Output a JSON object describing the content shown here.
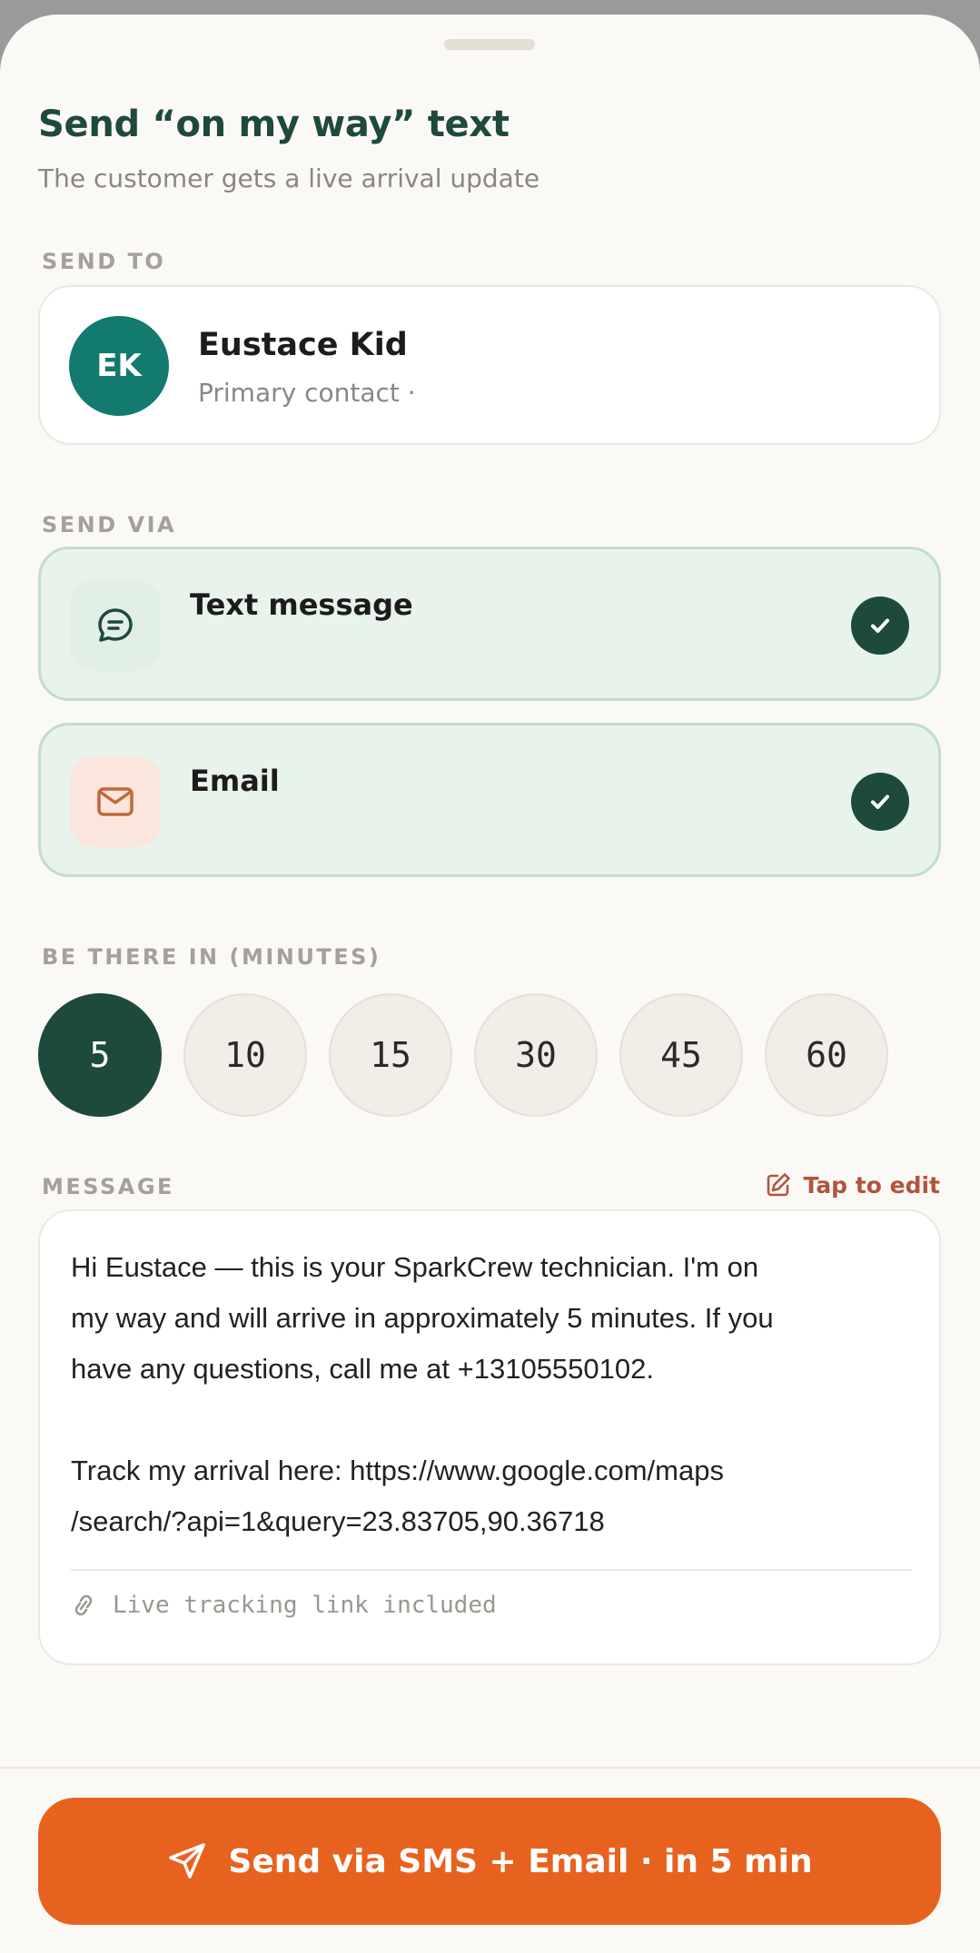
{
  "header": {
    "title": "Send “on my way” text",
    "subtitle": "The customer gets a live arrival update"
  },
  "send_to": {
    "label": "SEND TO",
    "initials": "EK",
    "name": "Eustace Kid",
    "subtitle": "Primary contact ·",
    "avatar_color": "#127a6e"
  },
  "send_via": {
    "label": "SEND VIA",
    "options": [
      {
        "label": "Text message",
        "icon": "chat-bubble-icon",
        "checked": true
      },
      {
        "label": "Email",
        "icon": "mail-icon",
        "checked": true
      }
    ]
  },
  "eta": {
    "label": "BE THERE IN (MINUTES)",
    "options": [
      "5",
      "10",
      "15",
      "30",
      "45",
      "60"
    ],
    "selected": "5"
  },
  "message": {
    "label": "MESSAGE",
    "edit_label": "Tap to edit",
    "body": "Hi Eustace — this is your SparkCrew technician. I'm on\nmy way and will arrive in approximately 5 minutes. If you\nhave any questions, call me at +13105550102.\n\nTrack my arrival here: https://www.google.com/maps\n/search/?api=1&query=23.83705,90.36718",
    "footer": "Live tracking link included"
  },
  "send_button": {
    "label": "Send via SMS + Email · in 5 min",
    "color": "#e8621f"
  },
  "colors": {
    "accent_dark": "#1d4a3c",
    "selected_bg": "#e8f3ec",
    "edit_color": "#b0553d"
  }
}
